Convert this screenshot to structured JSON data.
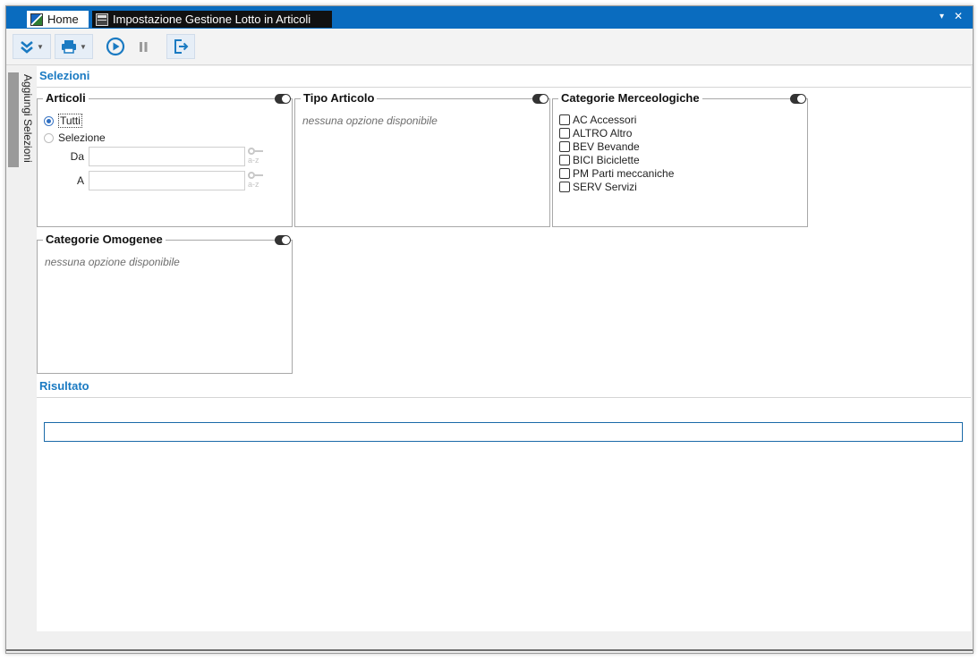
{
  "tabs": {
    "home": "Home",
    "active": "Impostazione Gestione Lotto in Articoli"
  },
  "window_controls": {
    "dropdown": "▾",
    "close": "✕"
  },
  "toolbar": {
    "icons": [
      "expand-all-icon",
      "print-icon",
      "run-icon",
      "pause-icon",
      "exit-icon"
    ],
    "accent": "#1a7ac2"
  },
  "sidebar": {
    "label": "Aggiungi Selezioni"
  },
  "sections": {
    "selezioni": "Selezioni",
    "risultato": "Risultato"
  },
  "articoli": {
    "title": "Articoli",
    "radio_all": "Tutti",
    "radio_selection": "Selezione",
    "from_label": "Da",
    "to_label": "A",
    "from_value": "",
    "to_value": "",
    "sort_badge": "a-z"
  },
  "tipo_articolo": {
    "title": "Tipo Articolo",
    "empty": "nessuna opzione disponibile"
  },
  "categorie_merceologiche": {
    "title": "Categorie Merceologiche",
    "items": [
      "AC Accessori",
      "ALTRO Altro",
      "BEV Bevande",
      "BICI Biciclette",
      "PM Parti meccaniche",
      "SERV Servizi"
    ]
  },
  "categorie_omogenee": {
    "title": "Categorie Omogenee",
    "empty": "nessuna opzione disponibile"
  },
  "risultato": {
    "value": ""
  }
}
